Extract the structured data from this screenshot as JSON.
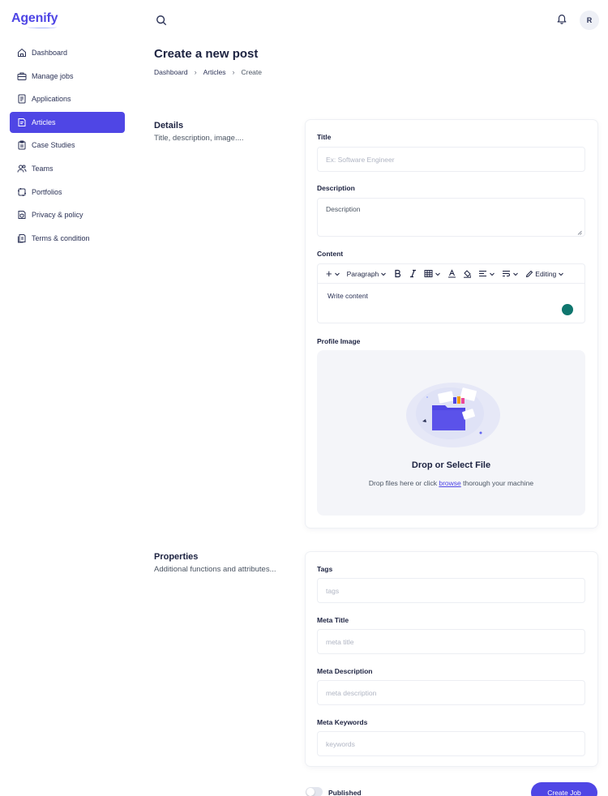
{
  "app": {
    "name": "Agenify",
    "user_initial": "R"
  },
  "sidebar": {
    "items": [
      {
        "label": "Dashboard",
        "icon": "home-icon"
      },
      {
        "label": "Manage jobs",
        "icon": "briefcase-icon"
      },
      {
        "label": "Applications",
        "icon": "document-icon"
      },
      {
        "label": "Articles",
        "icon": "article-icon",
        "active": true
      },
      {
        "label": "Case Studies",
        "icon": "clipboard-icon"
      },
      {
        "label": "Teams",
        "icon": "users-icon"
      },
      {
        "label": "Portfolios",
        "icon": "portfolio-icon"
      },
      {
        "label": "Privacy & policy",
        "icon": "shield-doc-icon"
      },
      {
        "label": "Terms & condition",
        "icon": "terms-icon"
      }
    ]
  },
  "header": {
    "title": "Create a new post",
    "breadcrumb": [
      "Dashboard",
      "Articles",
      "Create"
    ]
  },
  "details": {
    "heading": "Details",
    "subheading": "Title, description, image....",
    "title_label": "Title",
    "title_placeholder": "Ex: Software Engineer",
    "description_label": "Description",
    "description_placeholder": "Description",
    "content_label": "Content",
    "toolbar": {
      "insert": "+",
      "paragraph": "Paragraph",
      "editing": "Editing"
    },
    "content_placeholder": "Write content",
    "image_label": "Profile Image",
    "dropzone_title": "Drop or Select File",
    "dropzone_text_before": "Drop files here or click",
    "dropzone_link": "browse",
    "dropzone_text_after": "thorough your machine"
  },
  "properties": {
    "heading": "Properties",
    "subheading": "Additional functions and attributes...",
    "tags_label": "Tags",
    "tags_placeholder": "tags",
    "meta_title_label": "Meta Title",
    "meta_title_placeholder": "meta title",
    "meta_description_label": "Meta Description",
    "meta_description_placeholder": "meta description",
    "meta_keywords_label": "Meta Keywords",
    "meta_keywords_placeholder": "keywords"
  },
  "footer": {
    "published_label": "Published",
    "published": false,
    "create_button": "Create Job"
  },
  "colors": {
    "accent": "#4f46e5",
    "text": "#1c2240",
    "chat": "#0f766e"
  }
}
